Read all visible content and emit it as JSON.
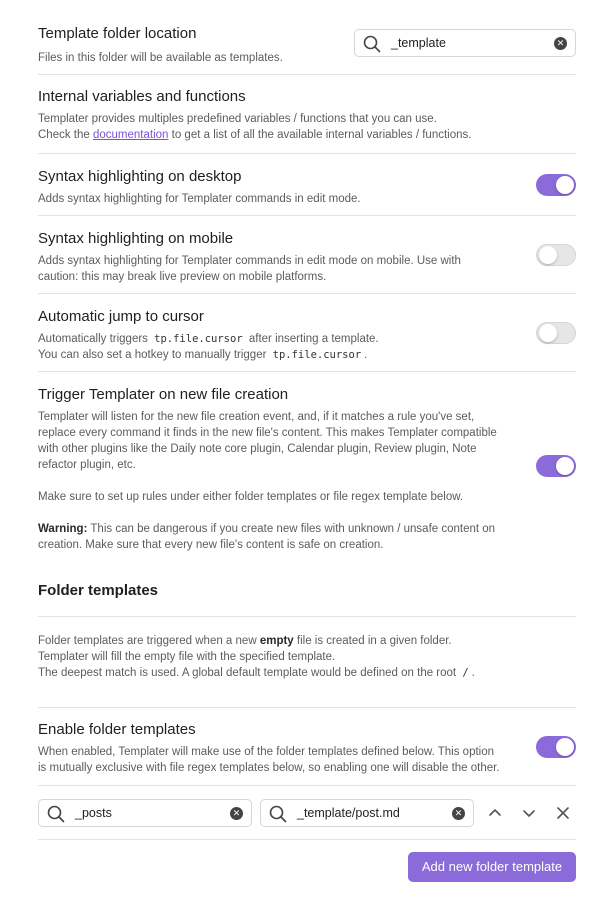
{
  "template_folder": {
    "name": "Template folder location",
    "desc": "Files in this folder will be available as templates.",
    "value": "_template"
  },
  "internal_vars": {
    "name": "Internal variables and functions",
    "desc_line1": "Templater provides multiples predefined variables / functions that you can use.",
    "desc_line2_pre": "Check the",
    "desc_link": "documentation",
    "desc_line2_post": "to get a list of all the available internal variables / functions."
  },
  "syntax_desktop": {
    "name": "Syntax highlighting on desktop",
    "desc": "Adds syntax highlighting for Templater commands in edit mode.",
    "enabled": true
  },
  "syntax_mobile": {
    "name": "Syntax highlighting on mobile",
    "desc_line1": "Adds syntax highlighting for Templater commands in edit mode on mobile. Use with",
    "desc_line2": "caution: this may break live preview on mobile platforms.",
    "enabled": false
  },
  "auto_jump": {
    "name": "Automatic jump to cursor",
    "desc_line1_pre": "Automatically triggers",
    "code": "tp.file.cursor",
    "desc_line1_post": "after inserting a template.",
    "desc_line2_pre": "You can also set a hotkey to manually trigger",
    "desc_line2_post": ".",
    "enabled": false
  },
  "trigger_new_file": {
    "name": "Trigger Templater on new file creation",
    "desc_line1": "Templater will listen for the new file creation event, and, if it matches a rule you've set,",
    "desc_line2": "replace every command it finds in the new file's content. This makes Templater compatible",
    "desc_line3": "with other plugins like the Daily note core plugin, Calendar plugin, Review plugin, Note",
    "desc_line4": "refactor plugin, etc.",
    "desc_line5": "Make sure to set up rules under either folder templates or file regex template below.",
    "warning_label": "Warning:",
    "warning_line1": "This can be dangerous if you create new files with unknown / unsafe content on",
    "warning_line2": "creation. Make sure that every new file's content is safe on creation.",
    "enabled": true
  },
  "folder_templates": {
    "heading": "Folder templates",
    "desc_line1_pre": "Folder templates are triggered when a new",
    "desc_line1_bold": "empty",
    "desc_line1_post": "file is created in a given folder.",
    "desc_line2": "Templater will fill the empty file with the specified template.",
    "desc_line3_pre": "The deepest match is used. A global default template would be defined on the root",
    "desc_line3_code": "/",
    "desc_line3_post": "."
  },
  "enable_folder_templates": {
    "name": "Enable folder templates",
    "desc_line1": "When enabled, Templater will make use of the folder templates defined below. This option",
    "desc_line2": "is mutually exclusive with file regex templates below, so enabling one will disable the other.",
    "enabled": true
  },
  "folder_rule": {
    "folder": "_posts",
    "template": "_template/post.md"
  },
  "add_button": "Add new folder template",
  "icons": [
    "search-icon",
    "clear-icon",
    "chevron-up-icon",
    "chevron-down-icon",
    "close-icon"
  ],
  "colors": {
    "accent": "#8b6ad9",
    "link": "#7b4fd6"
  }
}
